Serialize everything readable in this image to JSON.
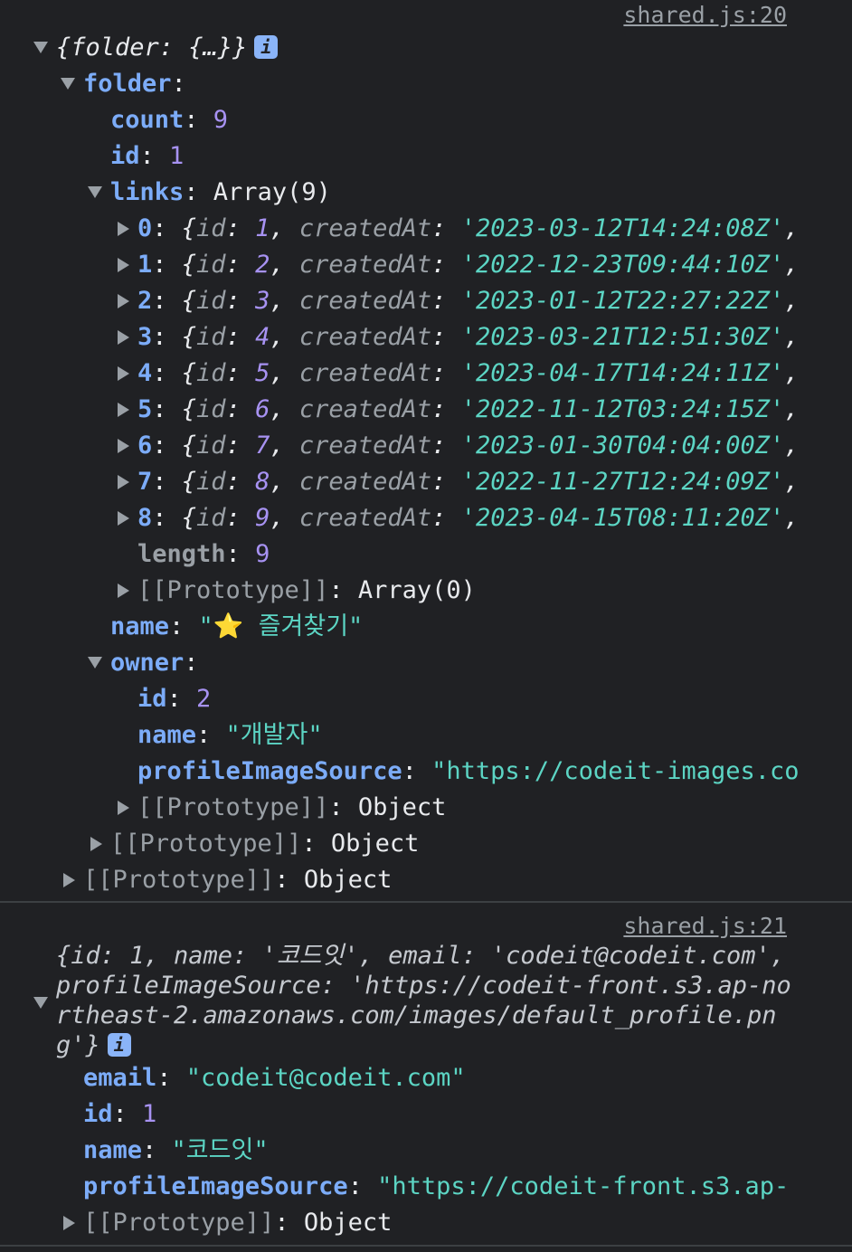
{
  "log1": {
    "source": "shared.js:20",
    "summary": "{folder: {…}}",
    "folder_key": "folder",
    "count_key": "count",
    "count_val": "9",
    "id_key": "id",
    "id_val": "1",
    "links_key": "links",
    "links_val": "Array(9)",
    "links": [
      {
        "index": "0",
        "id": "1",
        "createdAt": "'2023-03-12T14:24:08Z'"
      },
      {
        "index": "1",
        "id": "2",
        "createdAt": "'2022-12-23T09:44:10Z'"
      },
      {
        "index": "2",
        "id": "3",
        "createdAt": "'2023-01-12T22:27:22Z'"
      },
      {
        "index": "3",
        "id": "4",
        "createdAt": "'2023-03-21T12:51:30Z'"
      },
      {
        "index": "4",
        "id": "5",
        "createdAt": "'2023-04-17T14:24:11Z'"
      },
      {
        "index": "5",
        "id": "6",
        "createdAt": "'2022-11-12T03:24:15Z'"
      },
      {
        "index": "6",
        "id": "7",
        "createdAt": "'2023-01-30T04:04:00Z'"
      },
      {
        "index": "7",
        "id": "8",
        "createdAt": "'2022-11-27T12:24:09Z'"
      },
      {
        "index": "8",
        "id": "9",
        "createdAt": "'2023-04-15T08:11:20Z'"
      }
    ],
    "link_id_key": "id",
    "link_created_key": "createdAt",
    "length_key": "length",
    "length_val": "9",
    "array_proto_key": "[[Prototype]]",
    "array_proto_val": "Array(0)",
    "name_key": "name",
    "name_val": "\"⭐ 즐겨찾기\"",
    "owner_key": "owner",
    "owner_id_key": "id",
    "owner_id_val": "2",
    "owner_name_key": "name",
    "owner_name_val": "\"개발자\"",
    "owner_img_key": "profileImageSource",
    "owner_img_val": "\"https://codeit-images.co",
    "proto_key": "[[Prototype]]",
    "proto_val": "Object"
  },
  "log2": {
    "source": "shared.js:21",
    "summary": "{id: 1, name: '코드잇', email: 'codeit@codeit.com', profileImageSource: 'https://codeit-front.s3.ap-northeast-2.amazonaws.com/images/default_profile.png'}",
    "email_key": "email",
    "email_val": "\"codeit@codeit.com\"",
    "id_key": "id",
    "id_val": "1",
    "name_key": "name",
    "name_val": "\"코드잇\"",
    "img_key": "profileImageSource",
    "img_val": "\"https://codeit-front.s3.ap-",
    "proto_key": "[[Prototype]]",
    "proto_val": "Object"
  },
  "info_icon_label": "i"
}
